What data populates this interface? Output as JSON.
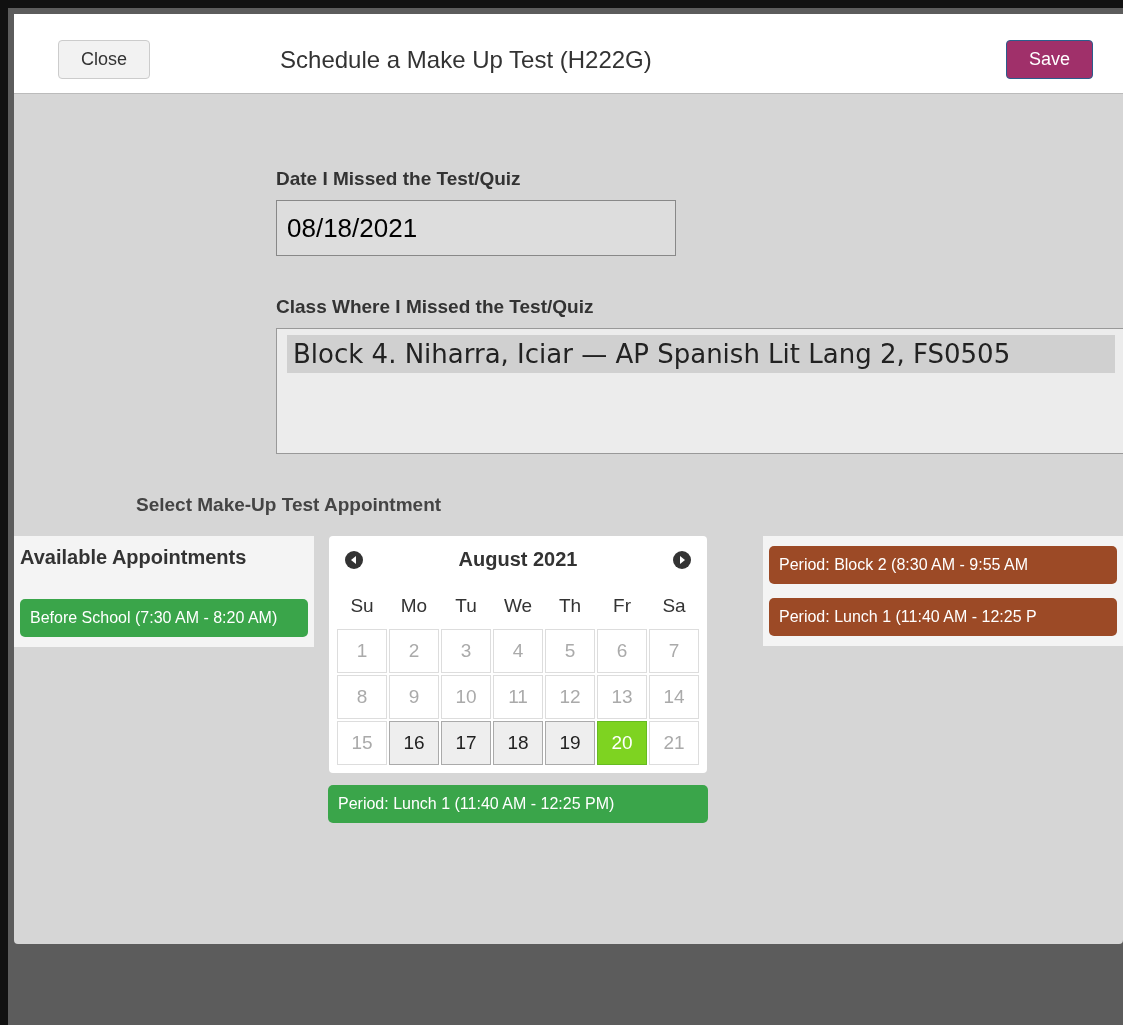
{
  "dialog": {
    "close_button": "Close",
    "title": "Schedule a Make Up Test (H222G)",
    "save_button": "Save"
  },
  "form": {
    "date_label": "Date I Missed the Test/Quiz",
    "date_value": "08/18/2021",
    "class_label": "Class Where I Missed the Test/Quiz",
    "class_options": [
      {
        "label": "Block 4. Niharra, Iciar — AP Spanish Lit Lang 2, FS0505",
        "selected": true
      }
    ]
  },
  "appointment_section": {
    "label": "Select Make-Up Test Appointment",
    "available_title": "Available Appointments",
    "left_appointments": [
      {
        "label": "Before School (7:30 AM - 8:20 AM)",
        "color": "#3aa54a"
      }
    ],
    "calendar": {
      "month": "August 2021",
      "weekdays": [
        "Su",
        "Mo",
        "Tu",
        "We",
        "Th",
        "Fr",
        "Sa"
      ],
      "weeks": [
        [
          {
            "day": "1",
            "disabled": true,
            "selected": false
          },
          {
            "day": "2",
            "disabled": true,
            "selected": false
          },
          {
            "day": "3",
            "disabled": true,
            "selected": false
          },
          {
            "day": "4",
            "disabled": true,
            "selected": false
          },
          {
            "day": "5",
            "disabled": true,
            "selected": false
          },
          {
            "day": "6",
            "disabled": true,
            "selected": false
          },
          {
            "day": "7",
            "disabled": true,
            "selected": false
          }
        ],
        [
          {
            "day": "8",
            "disabled": true,
            "selected": false
          },
          {
            "day": "9",
            "disabled": true,
            "selected": false
          },
          {
            "day": "10",
            "disabled": true,
            "selected": false
          },
          {
            "day": "11",
            "disabled": true,
            "selected": false
          },
          {
            "day": "12",
            "disabled": true,
            "selected": false
          },
          {
            "day": "13",
            "disabled": true,
            "selected": false
          },
          {
            "day": "14",
            "disabled": true,
            "selected": false
          }
        ],
        [
          {
            "day": "15",
            "disabled": true,
            "selected": false
          },
          {
            "day": "16",
            "disabled": false,
            "selected": false
          },
          {
            "day": "17",
            "disabled": false,
            "selected": false
          },
          {
            "day": "18",
            "disabled": false,
            "selected": false
          },
          {
            "day": "19",
            "disabled": false,
            "selected": false
          },
          {
            "day": "20",
            "disabled": false,
            "selected": true
          },
          {
            "day": "21",
            "disabled": true,
            "selected": false
          }
        ]
      ]
    },
    "below_calendar": [
      {
        "label": "Period: Lunch 1 (11:40 AM - 12:25 PM)",
        "color": "#3aa54a"
      }
    ],
    "right_appointments": [
      {
        "label": "Period: Block 2 (8:30 AM - 9:55 AM",
        "color": "#9c4a26"
      },
      {
        "label": "Period: Lunch 1 (11:40 AM - 12:25 P",
        "color": "#9c4a26"
      }
    ]
  }
}
